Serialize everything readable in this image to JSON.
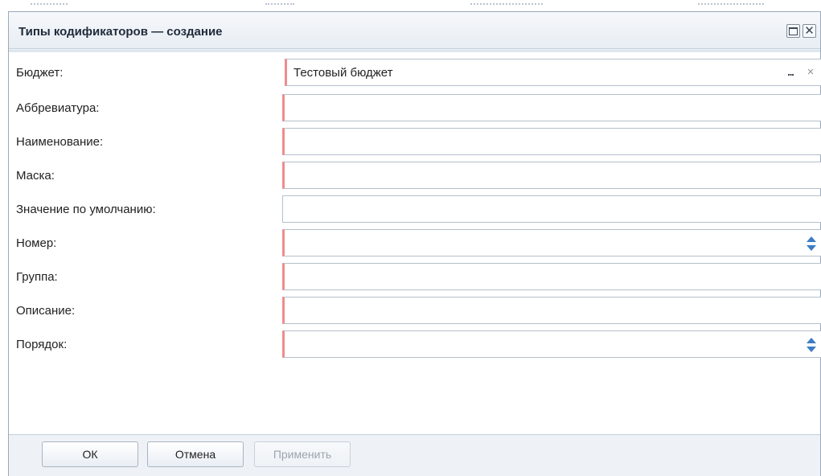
{
  "window": {
    "title": "Типы кодификаторов — создание",
    "close_glyph": "✕"
  },
  "form": {
    "fields": [
      {
        "label": "Бюджет:",
        "value": "Тестовый бюджет",
        "required": true,
        "type": "lookup"
      },
      {
        "label": "Аббревиатура:",
        "value": "",
        "required": true,
        "type": "text"
      },
      {
        "label": "Наименование:",
        "value": "",
        "required": true,
        "type": "text"
      },
      {
        "label": "Маска:",
        "value": "",
        "required": true,
        "type": "text"
      },
      {
        "label": "Значение по умолчанию:",
        "value": "",
        "required": false,
        "type": "text"
      },
      {
        "label": "Номер:",
        "value": "",
        "required": true,
        "type": "number"
      },
      {
        "label": "Группа:",
        "value": "",
        "required": true,
        "type": "text"
      },
      {
        "label": "Описание:",
        "value": "",
        "required": true,
        "type": "text"
      },
      {
        "label": "Порядок:",
        "value": "",
        "required": true,
        "type": "number"
      }
    ],
    "lookup_button": "...",
    "clear_button": "×"
  },
  "footer": {
    "ok_label": "ОК",
    "cancel_label": "Отмена",
    "apply_label": "Применить"
  },
  "colors": {
    "required_marker": "#f08c8c",
    "spinner_arrow": "#3c7cc4",
    "window_border": "#99a9bb"
  }
}
